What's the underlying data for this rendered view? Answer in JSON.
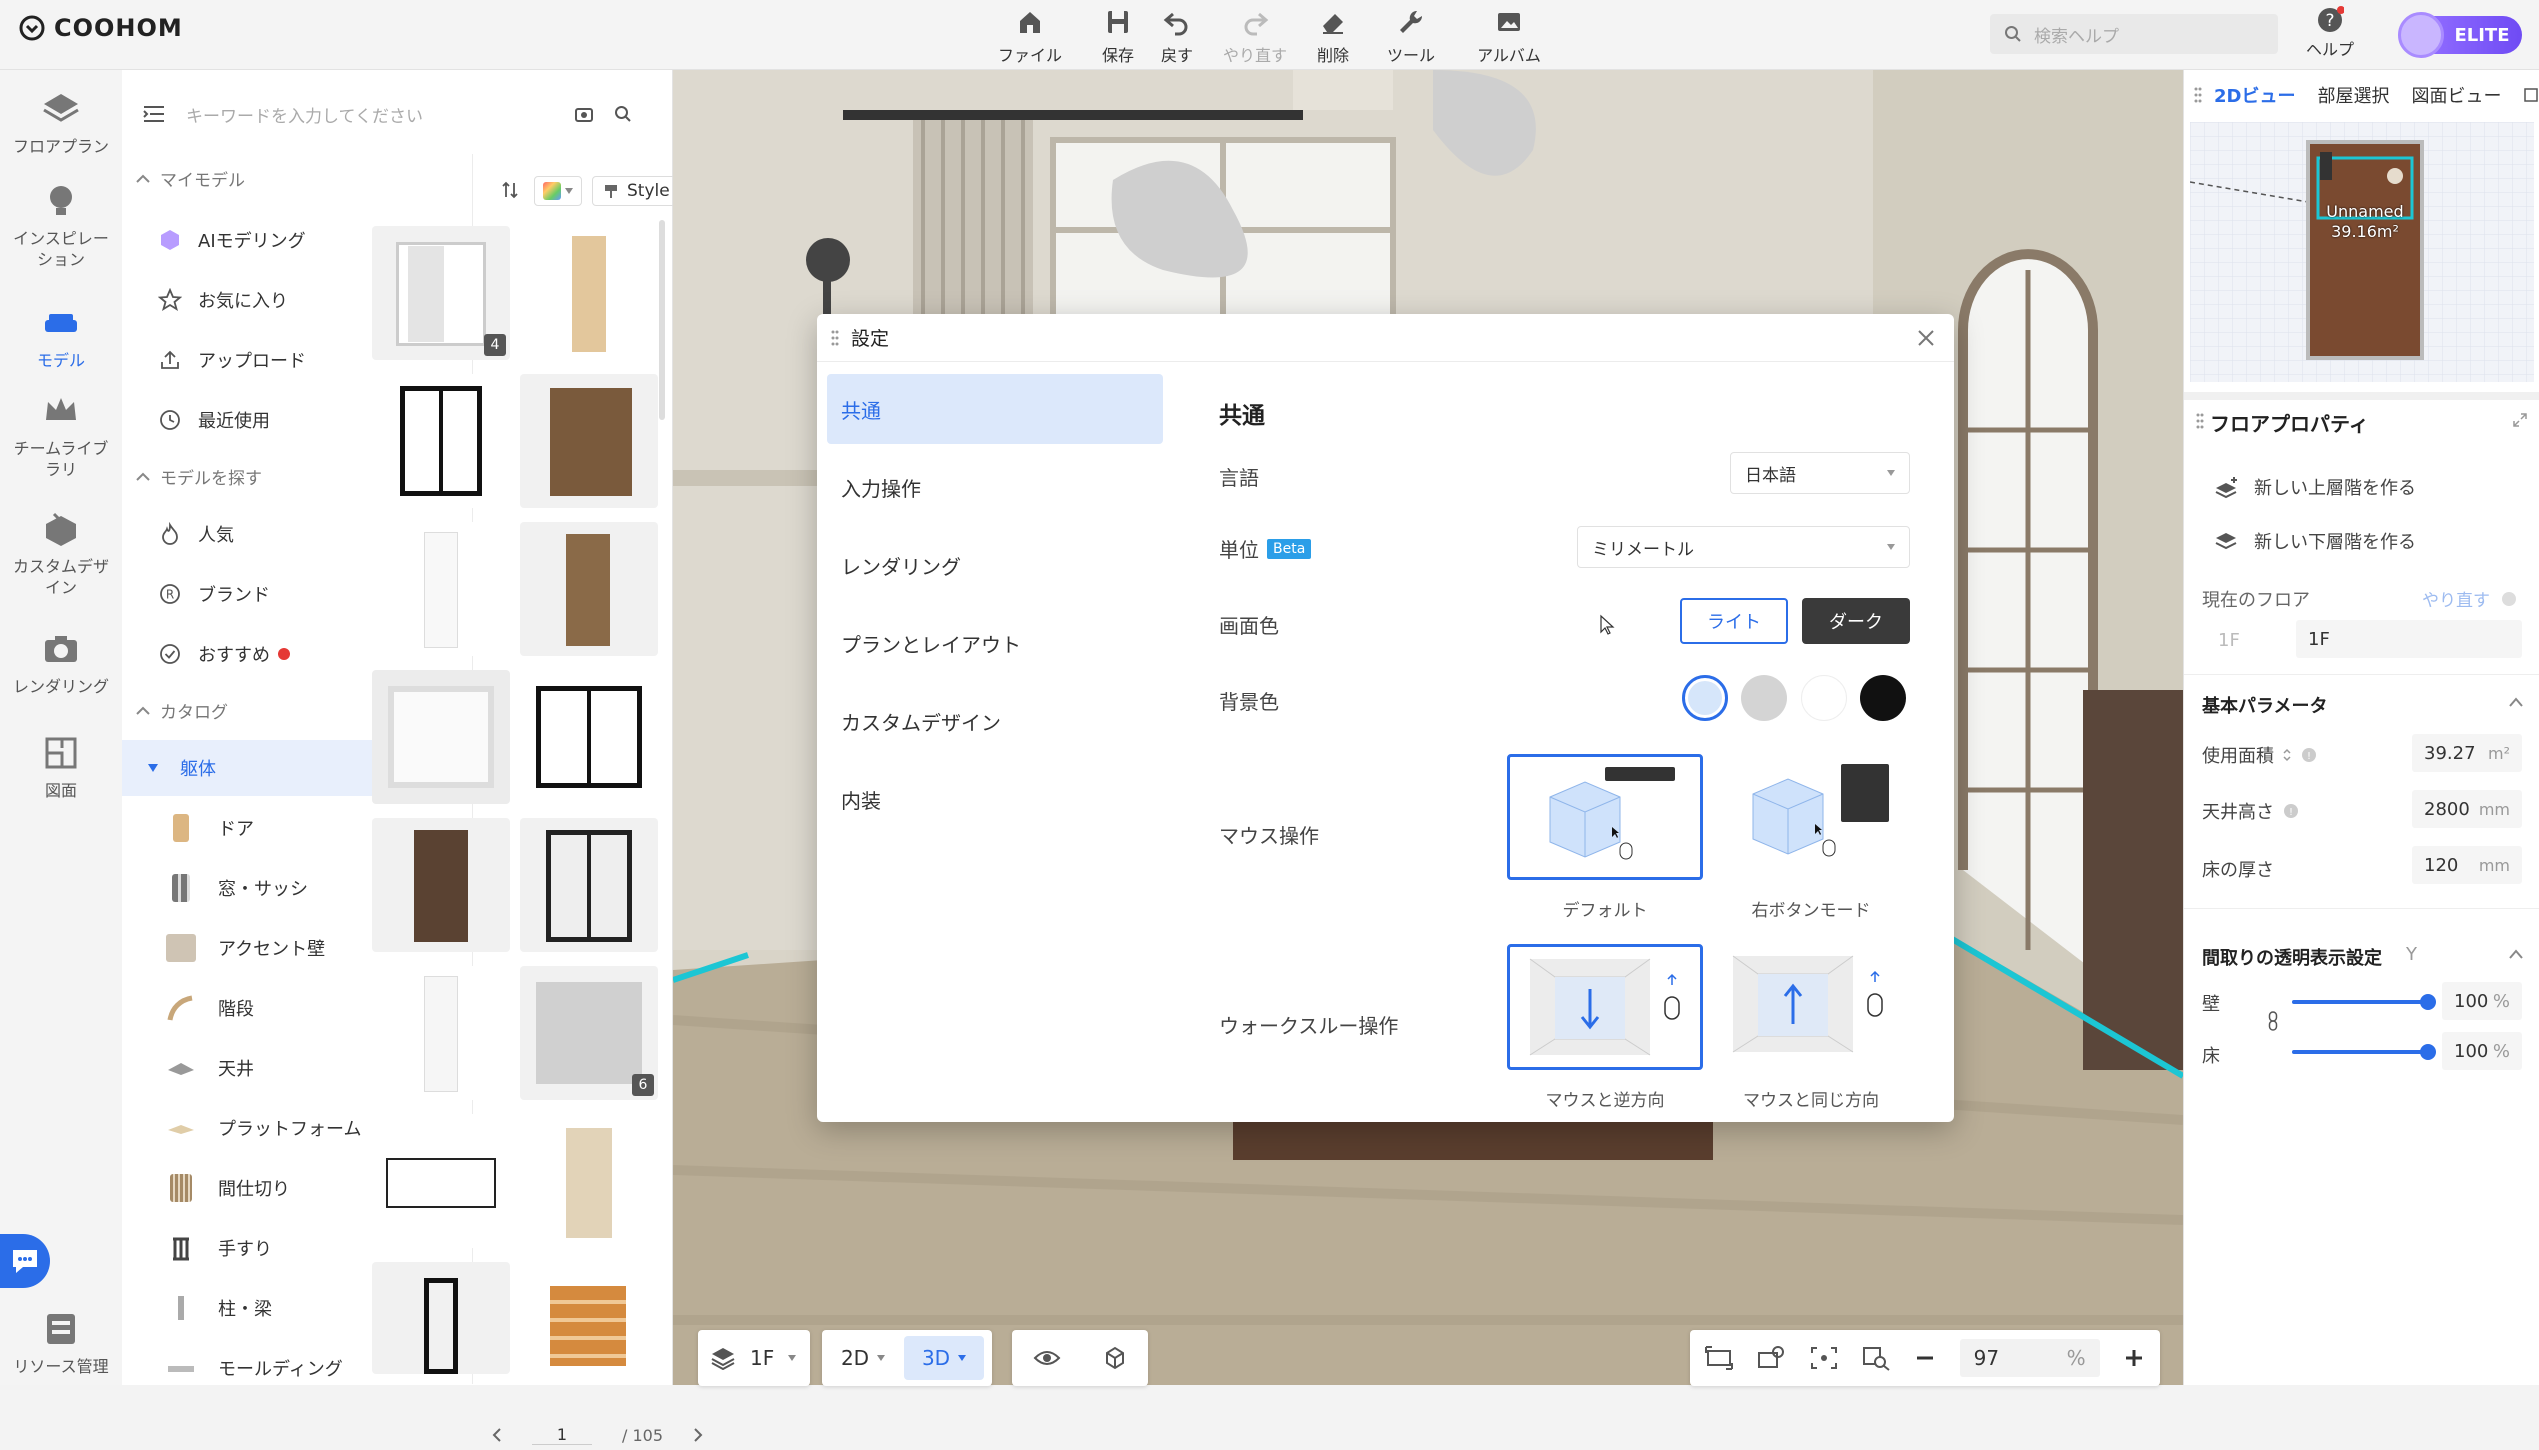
{
  "app": {
    "brand": "COOHOM"
  },
  "toolbar": {
    "file": "ファイル",
    "save": "保存",
    "undo": "戻す",
    "redo": "やり直す",
    "delete": "削除",
    "tools": "ツール",
    "album": "アルバム"
  },
  "search_help": {
    "placeholder": "検索ヘルプ"
  },
  "help": {
    "label": "ヘルプ"
  },
  "plan": {
    "badge": "ELITE"
  },
  "rail": {
    "floorplan": "フロアプラン",
    "inspiration": "インスピレーション",
    "model": "モデル",
    "team_library": "チームライブラリ",
    "custom_design": "カスタムデザイン",
    "rendering": "レンダリング",
    "drawing": "図面",
    "resource_management": "リソース管理"
  },
  "model_panel": {
    "search_placeholder": "キーワードを入力してください",
    "my_models": {
      "title": "マイモデル",
      "items": [
        "AIモデリング",
        "お気に入り",
        "アップロード",
        "最近使用"
      ]
    },
    "find_models": {
      "title": "モデルを探す",
      "items": [
        "人気",
        "ブランド",
        "おすすめ"
      ]
    },
    "catalog": {
      "title": "カタログ",
      "active": "躯体",
      "items": [
        "ドア",
        "窓・サッシ",
        "アクセント壁",
        "階段",
        "天井",
        "プラットフォーム",
        "間仕切り",
        "手すり",
        "柱・梁",
        "モールディング"
      ]
    },
    "filter": {
      "style": "Style"
    },
    "thumb_badges": {
      "first": "4",
      "last": "6"
    },
    "pager": {
      "page": "1",
      "total": "/ 105"
    }
  },
  "dialog": {
    "title": "設定",
    "tabs": [
      "共通",
      "入力操作",
      "レンダリング",
      "プランとレイアウト",
      "カスタムデザイン",
      "内装"
    ],
    "active_tab": "共通",
    "section_title": "共通",
    "language": {
      "label": "言語",
      "value": "日本語"
    },
    "unit": {
      "label": "単位",
      "badge": "Beta",
      "value": "ミリメートル"
    },
    "screen_color": {
      "label": "画面色",
      "light": "ライト",
      "dark": "ダーク"
    },
    "background_color": {
      "label": "背景色",
      "swatches": [
        "#d6e6fa",
        "#d4d4d4",
        "#ffffff",
        "#111111"
      ]
    },
    "mouse": {
      "label": "マウス操作",
      "default": "デフォルト",
      "right_button": "右ボタンモード"
    },
    "walkthrough": {
      "label": "ウォークスルー操作",
      "reverse": "マウスと逆方向",
      "same": "マウスと同じ方向"
    }
  },
  "right_panel": {
    "tabs": [
      "2Dビュー",
      "部屋選択",
      "図面ビュー"
    ],
    "minimap": {
      "room_name": "Unnamed",
      "room_area": "39.16m²"
    },
    "floor_props_title": "フロアプロパティ",
    "new_upper": "新しい上層階を作る",
    "new_lower": "新しい下層階を作る",
    "current_floor": {
      "label": "現在のフロア",
      "redo": "やり直す",
      "prefix": "1F",
      "value": "1F"
    },
    "basic_params": {
      "title": "基本パラメータ",
      "area": {
        "label": "使用面積",
        "value": "39.27",
        "unit": "m²"
      },
      "ceiling": {
        "label": "天井高さ",
        "value": "2800",
        "unit": "mm"
      },
      "floor_thickness": {
        "label": "床の厚さ",
        "value": "120",
        "unit": "mm"
      }
    },
    "transparency": {
      "title": "間取りの透明表示設定",
      "suffix": "Y",
      "wall": {
        "label": "壁",
        "value": "100",
        "unit": "%",
        "level": 1.0
      },
      "floor": {
        "label": "床",
        "value": "100",
        "unit": "%",
        "level": 1.0
      }
    }
  },
  "viewport_controls": {
    "floor": "1F",
    "mode_2d": "2D",
    "mode_3d": "3D",
    "zoom": "97",
    "zoom_unit": "%"
  },
  "colors": {
    "accent": "#2b6de8",
    "dark_button": "#3a3a3a",
    "elite": "#7c5cfa"
  }
}
